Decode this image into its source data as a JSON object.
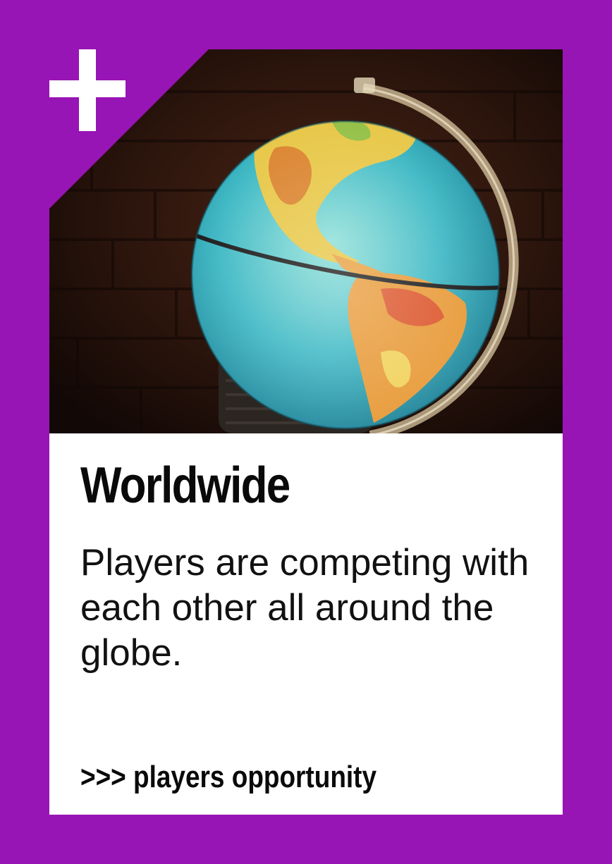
{
  "card": {
    "title": "Worldwide",
    "description": "Players are competing with each other all around the globe.",
    "tagline": ">>> players opportunity"
  },
  "icons": {
    "corner": "plus-icon",
    "photo": "globe-photo"
  },
  "colors": {
    "background": "#9815b5",
    "panel": "#ffffff",
    "text": "#0a0a0a",
    "ocean": "#3cb8c4",
    "land": "#e8c84a"
  }
}
